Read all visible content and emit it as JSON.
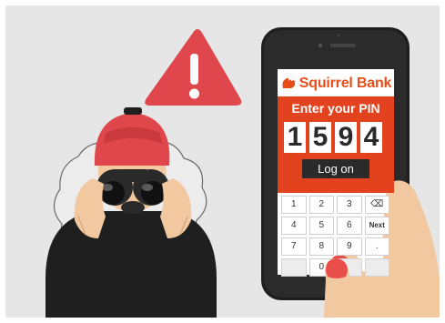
{
  "brand": {
    "name": "Squirrel Bank",
    "color": "#e84e1b"
  },
  "pin_screen": {
    "prompt": "Enter your PIN",
    "digits": [
      "1",
      "5",
      "9",
      "4"
    ],
    "login_label": "Log on",
    "accent_color": "#e3421f"
  },
  "keypad": {
    "keys": [
      "1",
      "2",
      "3",
      "⌫",
      "4",
      "5",
      "6",
      "Next",
      "7",
      "8",
      "9",
      ".",
      "",
      "0",
      "",
      ""
    ]
  },
  "icons": {
    "warning": "warning-triangle-icon",
    "backspace": "backspace-icon",
    "squirrel": "squirrel-logo-icon"
  }
}
